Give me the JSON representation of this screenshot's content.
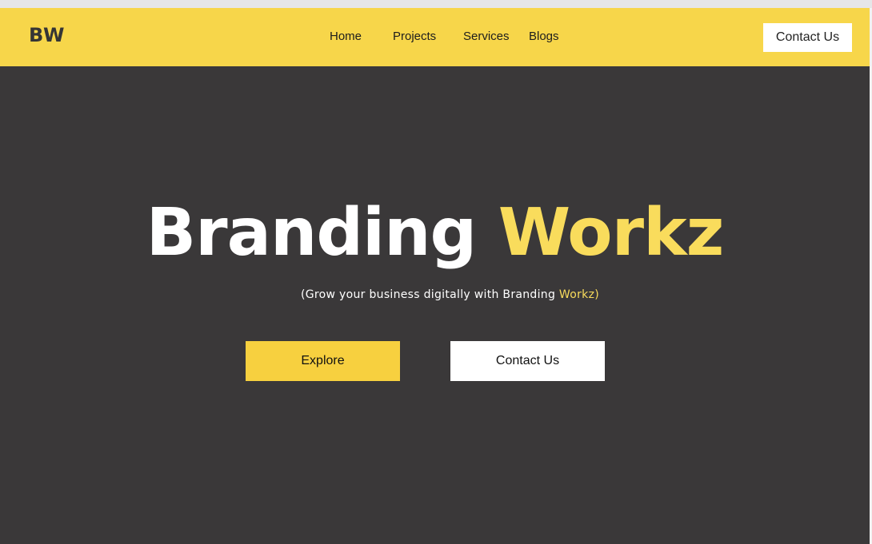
{
  "header": {
    "logo": "BW",
    "nav": [
      {
        "label": "Home"
      },
      {
        "label": "Projects"
      },
      {
        "label": "Services"
      },
      {
        "label": "Blogs"
      }
    ],
    "contact_label": "Contact Us"
  },
  "hero": {
    "title_main": "Branding",
    "title_accent": "Workz",
    "subtitle_prefix": "(Grow your business digitally with Branding ",
    "subtitle_accent": "Workz",
    "subtitle_suffix": ")",
    "explore_label": "Explore",
    "contact_label": "Contact Us"
  },
  "colors": {
    "brand_yellow": "#f7d64a",
    "accent_text": "#f9dc5c",
    "hero_bg": "#3a3839",
    "white": "#ffffff"
  }
}
